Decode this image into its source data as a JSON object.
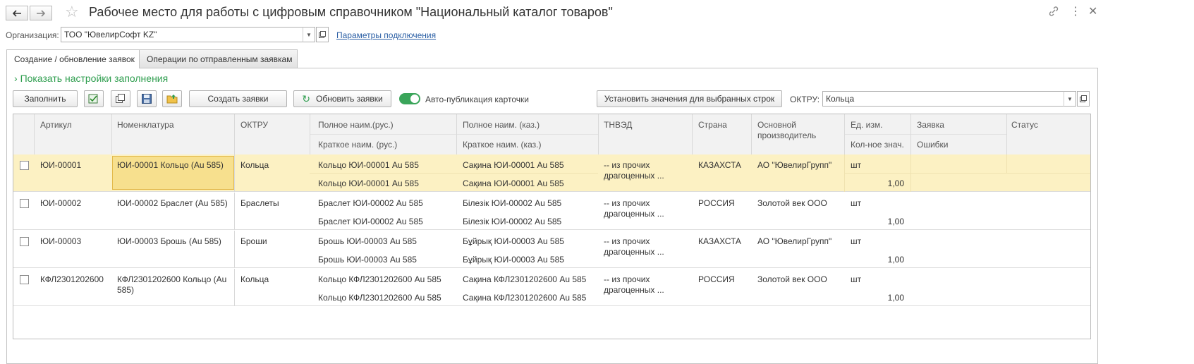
{
  "window": {
    "title": "Рабочее место для работы с цифровым справочником \"Национальный каталог товаров\""
  },
  "org": {
    "label": "Организация:",
    "value": "ТОО \"ЮвелирСофт KZ\"",
    "link": "Параметры подключения"
  },
  "tabs": [
    {
      "label": "Создание / обновление заявок",
      "active": true
    },
    {
      "label": "Операции по отправленным заявкам",
      "active": false
    }
  ],
  "settings_toggle": "Показать настройки заполнения",
  "toolbar": {
    "fill": "Заполнить",
    "create": "Создать заявки",
    "update": "Обновить заявки",
    "autopub": "Авто-публикация карточки",
    "set_values": "Установить значения для выбранных строк",
    "oktru_label": "ОКТРУ:",
    "oktru_value": "Кольца"
  },
  "table": {
    "headers": {
      "article": "Артикул",
      "nomenclature": "Номенклатура",
      "oktru": "ОКТРУ",
      "full_rus": "Полное наим.(рус.)",
      "short_rus": "Краткое наим. (рус.)",
      "full_kaz": "Полное наим. (каз.)",
      "short_kaz": "Краткое наим. (каз.)",
      "tnved": "ТНВЭД",
      "country": "Страна",
      "manufacturer": "Основной производитель",
      "unit": "Ед. изм.",
      "qty": "Кол-ное знач.",
      "request": "Заявка",
      "errors": "Ошибки",
      "status": "Статус"
    },
    "rows": [
      {
        "article": "ЮИ-00001",
        "nomenclature": "ЮИ-00001 Кольцо (Au 585)",
        "oktru": "Кольца",
        "full_rus": "Кольцо ЮИ-00001 Au 585",
        "short_rus": "Кольцо ЮИ-00001 Au 585",
        "full_kaz": "Сақина ЮИ-00001 Au 585",
        "short_kaz": "Сақина ЮИ-00001 Au 585",
        "tnved": "-- из прочих драгоценных ...",
        "country": "КАЗАХСТА",
        "manufacturer": "АО \"ЮвелирГрупп\"",
        "unit": "шт",
        "qty": "1,00"
      },
      {
        "article": "ЮИ-00002",
        "nomenclature": "ЮИ-00002 Браслет (Au 585)",
        "oktru": "Браслеты",
        "full_rus": "Браслет ЮИ-00002 Au 585",
        "short_rus": "Браслет ЮИ-00002 Au 585",
        "full_kaz": "Білезік ЮИ-00002 Au 585",
        "short_kaz": "Білезік ЮИ-00002 Au 585",
        "tnved": "-- из прочих драгоценных ...",
        "country": "РОССИЯ",
        "manufacturer": "Золотой век ООО",
        "unit": "шт",
        "qty": "1,00"
      },
      {
        "article": "ЮИ-00003",
        "nomenclature": "ЮИ-00003 Брошь (Au 585)",
        "oktru": "Броши",
        "full_rus": "Брошь ЮИ-00003 Au 585",
        "short_rus": "Брошь ЮИ-00003 Au 585",
        "full_kaz": "Бұйрық ЮИ-00003 Au 585",
        "short_kaz": "Бұйрық ЮИ-00003 Au 585",
        "tnved": "-- из прочих драгоценных ...",
        "country": "КАЗАХСТА",
        "manufacturer": "АО \"ЮвелирГрупп\"",
        "unit": "шт",
        "qty": "1,00"
      },
      {
        "article": "КФЛ2301202600",
        "nomenclature": "КФЛ2301202600 Кольцо (Au 585)",
        "oktru": "Кольца",
        "full_rus": "Кольцо КФЛ2301202600 Au 585",
        "short_rus": "Кольцо КФЛ2301202600 Au 585",
        "full_kaz": "Сақина КФЛ2301202600 Au 585",
        "short_kaz": "Сақина КФЛ2301202600 Au 585",
        "tnved": "-- из прочих драгоценных ...",
        "country": "РОССИЯ",
        "manufacturer": "Золотой век ООО",
        "unit": "шт",
        "qty": "1,00"
      }
    ]
  },
  "colors": {
    "accent_green": "#2f9e4f",
    "selected_row": "#fcf1c3",
    "link": "#2b5fa5"
  }
}
